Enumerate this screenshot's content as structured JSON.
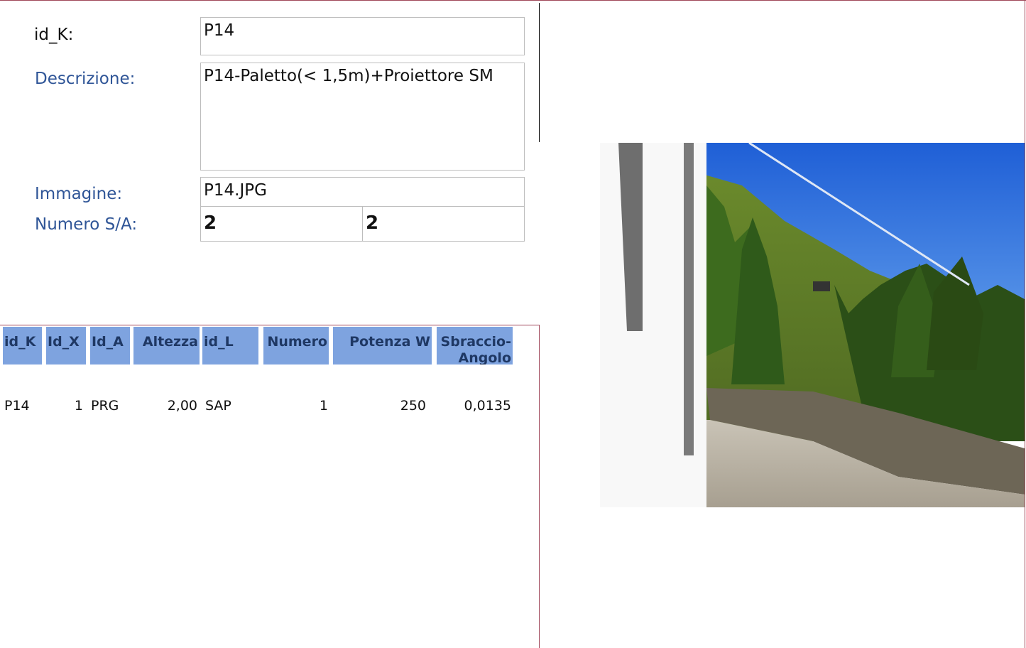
{
  "form": {
    "id_k_label": "id_K:",
    "id_k_value": "P14",
    "descrizione_label": "Descrizione:",
    "descrizione_value": "P14-Paletto(< 1,5m)+Proiettore SM",
    "immagine_label": "Immagine:",
    "immagine_value": "P14.JPG",
    "numero_sa_label": "Numero S/A:",
    "numero_s_value": "2",
    "numero_a_value": "2"
  },
  "table": {
    "headers": [
      "id_K",
      "Id_X",
      "Id_A",
      "Altezza",
      "id_L",
      "Numero",
      "Potenza W",
      "Sbraccio-Angolo"
    ],
    "rows": [
      [
        "P14",
        "1",
        "PRG",
        "2,00",
        "SAP",
        "1",
        "250",
        "0,0135"
      ]
    ]
  },
  "colors": {
    "header_bg": "#7ea3df",
    "header_text": "#1f3864",
    "label_blue": "#2f5597",
    "frame": "#a0485a"
  }
}
